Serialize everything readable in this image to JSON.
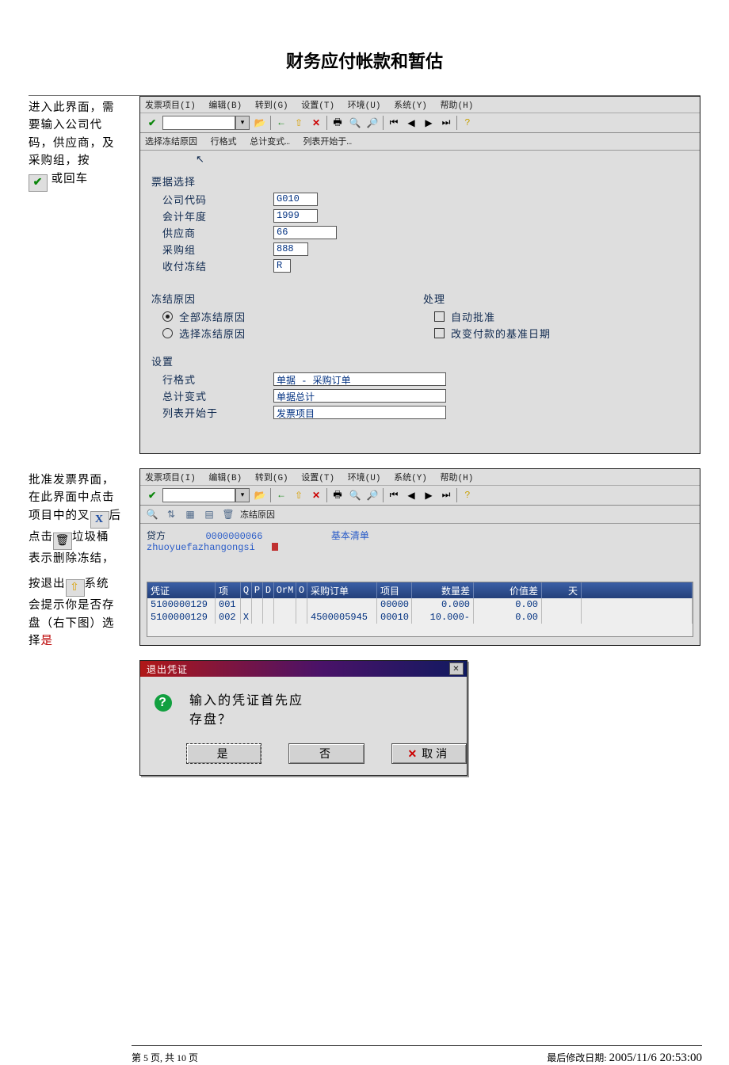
{
  "document": {
    "title": "财务应付帐款和暂估",
    "footer_page": "第 5 页, 共 10 页",
    "footer_mod_label": "最后修改日期:",
    "footer_mod_value": "2005/11/6 20:53:00"
  },
  "instr1": {
    "line1": "进入此界面，需",
    "line2": "要输入公司代",
    "line3": "码，供应商，及",
    "line4": "采购组，按",
    "line5_tail": "或回车",
    "check_glyph": "✔"
  },
  "instr2": {
    "line1": "批准发票界面，",
    "line2": "在此界面中点击",
    "line3_pre": "项目中的叉",
    "line3_icon": "X",
    "line3_suf": "后",
    "line4_pre": "点击",
    "line4_suf": "垃圾桶",
    "trash_glyph": "🗑",
    "line5": "表示删除冻结，",
    "line6_pre": "按退出",
    "line6_suf": "系统",
    "exit_glyph": "⇧",
    "line7": "会提示你是否存",
    "line8": "盘（右下图）选",
    "line9_pre": "择",
    "line9_red": "是"
  },
  "sap": {
    "menu": [
      "发票项目(I)",
      "编辑(B)",
      "转到(G)",
      "设置(T)",
      "环境(U)",
      "系统(Y)",
      "帮助(H)"
    ],
    "subbar1": [
      "选择冻结原因",
      "行格式",
      "总计变式…",
      "列表开始于…"
    ],
    "group_bill": "票据选择",
    "f_company": "公司代码",
    "f_year": "会计年度",
    "f_vendor": "供应商",
    "f_pgroup": "采购组",
    "f_block": "收付冻结",
    "v_company": "G010",
    "v_year": "1999",
    "v_vendor": "66",
    "v_pgroup": "888",
    "v_block": "R",
    "group_reason": "冻结原因",
    "r_all": "全部冻结原因",
    "r_select": "选择冻结原因",
    "group_proc": "处理",
    "c_auto": "自动批准",
    "c_change_date": "改变付款的基准日期",
    "group_set": "设置",
    "f_linefmt": "行格式",
    "v_linefmt": "单据 - 采购订单",
    "f_totfmt": "总计变式",
    "v_totfmt": "单据总计",
    "f_liststart": "列表开始于",
    "v_liststart": "发票项目"
  },
  "sap2": {
    "subbar_label": "冻结原因",
    "info_credit": "贷方",
    "info_code": "0000000066",
    "info_basic": "基本清单",
    "info_name": "zhuoyuefazhangongsi",
    "head": {
      "voucher": "凭证",
      "item": "项",
      "q": "Q",
      "p": "P",
      "d": "D",
      "orm": "OrM",
      "o": "O",
      "po": "采购订单",
      "poitem": "项目",
      "qtydiff": "数量差",
      "valdiff": "价值差",
      "days": "天"
    },
    "rows": [
      {
        "voucher": "5100000129",
        "item": "001",
        "x": "",
        "po": "",
        "poitem": "00000",
        "qty": "0.000",
        "val": "0.00"
      },
      {
        "voucher": "5100000129",
        "item": "002",
        "x": "X",
        "po": "4500005945",
        "poitem": "00010",
        "qty": "10.000-",
        "val": "0.00"
      }
    ]
  },
  "dialog": {
    "title": "退出凭证",
    "line1": "输入的凭证首先应",
    "line2": "存盘？",
    "yes": "是",
    "no": "否",
    "cancel": "取消"
  }
}
